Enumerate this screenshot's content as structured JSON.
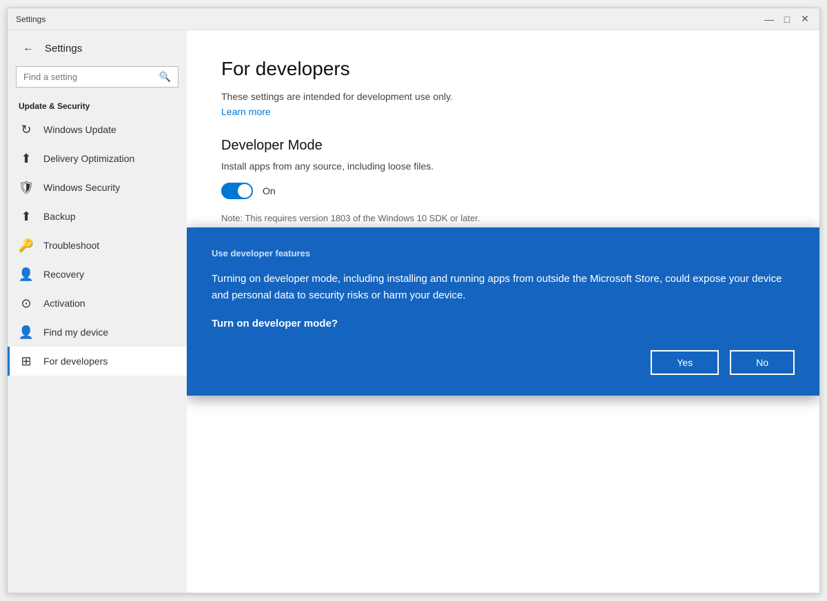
{
  "window": {
    "title": "Settings",
    "controls": {
      "minimize": "—",
      "maximize": "□",
      "close": "✕"
    }
  },
  "sidebar": {
    "back_icon": "←",
    "app_title": "Settings",
    "search": {
      "placeholder": "Find a setting",
      "icon": "🔍"
    },
    "section_header": "Update & Security",
    "items": [
      {
        "id": "windows-update",
        "label": "Windows Update",
        "icon": "↻"
      },
      {
        "id": "delivery-optimization",
        "label": "Delivery Optimization",
        "icon": "⬆"
      },
      {
        "id": "windows-security",
        "label": "Windows Security",
        "icon": "🛡"
      },
      {
        "id": "backup",
        "label": "Backup",
        "icon": "⬆"
      },
      {
        "id": "troubleshoot",
        "label": "Troubleshoot",
        "icon": "🔑"
      },
      {
        "id": "recovery",
        "label": "Recovery",
        "icon": "👤"
      },
      {
        "id": "activation",
        "label": "Activation",
        "icon": "✅"
      },
      {
        "id": "find-my-device",
        "label": "Find my device",
        "icon": "👤"
      },
      {
        "id": "for-developers",
        "label": "For developers",
        "icon": "⊞",
        "active": true
      }
    ]
  },
  "main": {
    "page_title": "For developers",
    "subtitle": "These settings are intended for development use only.",
    "learn_more": "Learn more",
    "developer_mode": {
      "section_title": "Developer Mode",
      "description": "Install apps from any source, including loose files.",
      "toggle_state": "On",
      "toggle_on": true
    },
    "note": "Note: This requires version 1803 of the Windows 10 SDK or later."
  },
  "dialog": {
    "header": "Use developer features",
    "body": "Turning on developer mode, including installing and running apps from outside the Microsoft Store, could expose your device and personal data to security risks or harm your device.",
    "question": "Turn on developer mode?",
    "yes_label": "Yes",
    "no_label": "No"
  }
}
